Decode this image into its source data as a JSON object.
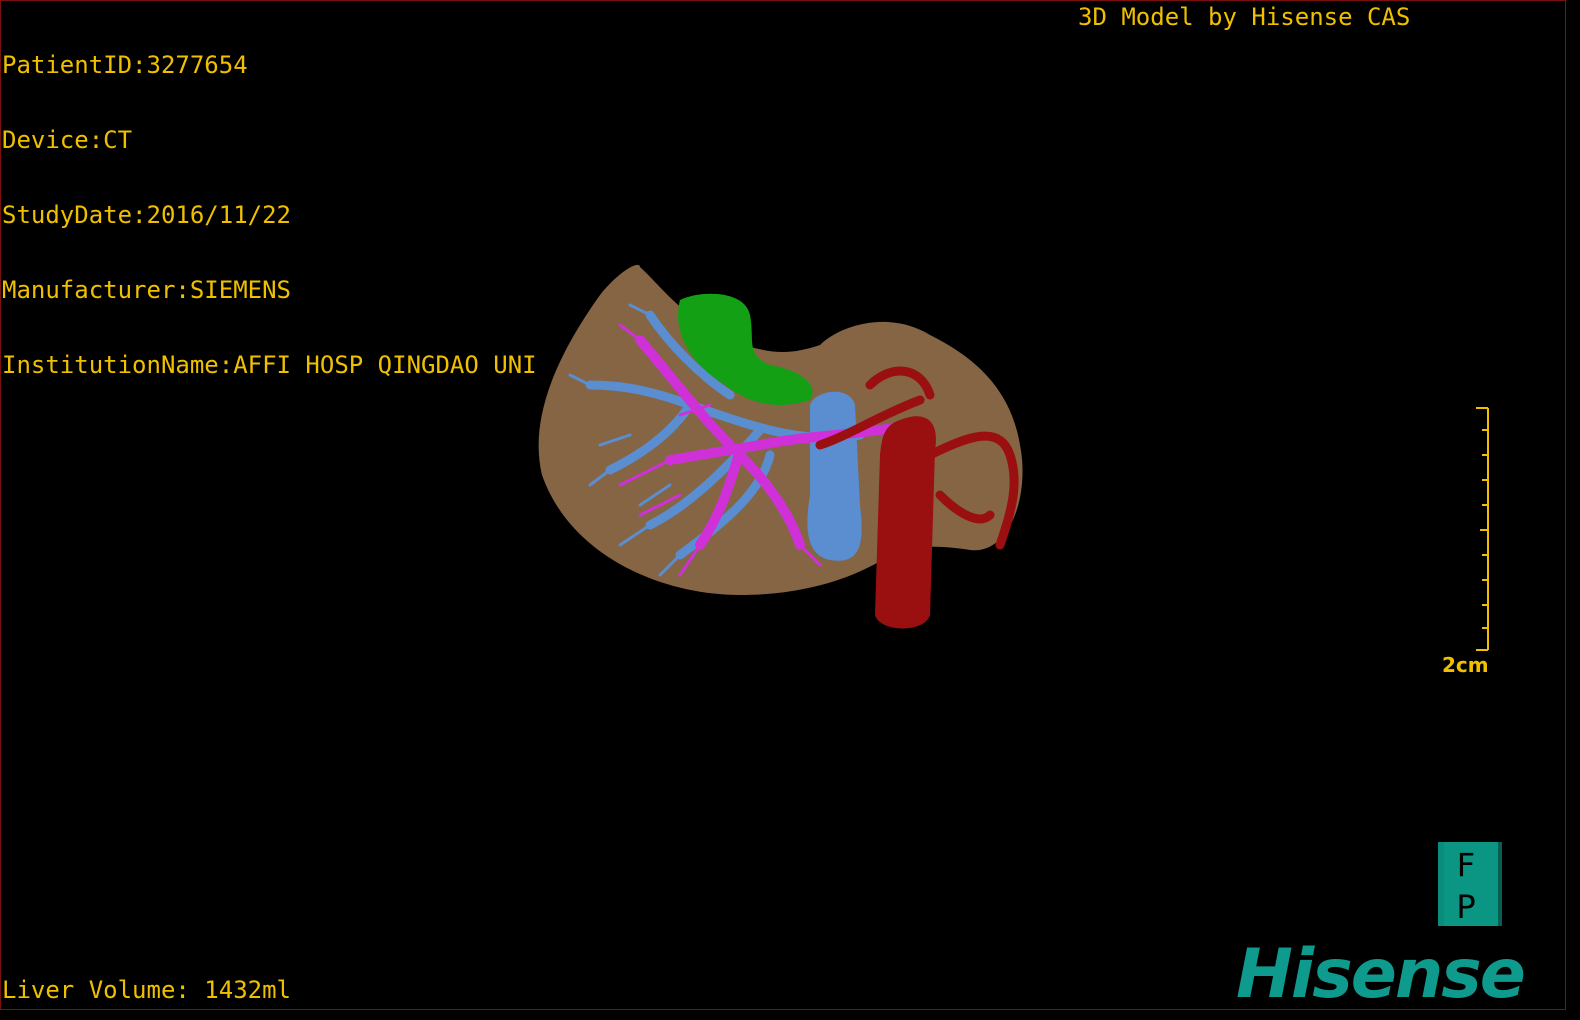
{
  "info": {
    "patient_id": "PatientID:3277654",
    "device": "Device:CT",
    "study_date": "StudyDate:2016/11/22",
    "manufacturer": "Manufacturer:SIEMENS",
    "institution": "InstitutionName:AFFI HOSP QINGDAO UNI"
  },
  "title": "3D Model by Hisense CAS",
  "liver_volume": "Liver Volume: 1432ml",
  "scale_label": "2cm",
  "orientation": {
    "top": "F",
    "bottom": "P"
  },
  "logo": "Hisense",
  "colors": {
    "text": "#f0c000",
    "liver": "#8c6a48",
    "portal_vein": "#d030d8",
    "hepatic_vein": "#5a8ed0",
    "artery": "#9a1010",
    "gallbladder": "#14a014",
    "logo": "#0e9a8c",
    "cube": "#0a8c7c"
  }
}
